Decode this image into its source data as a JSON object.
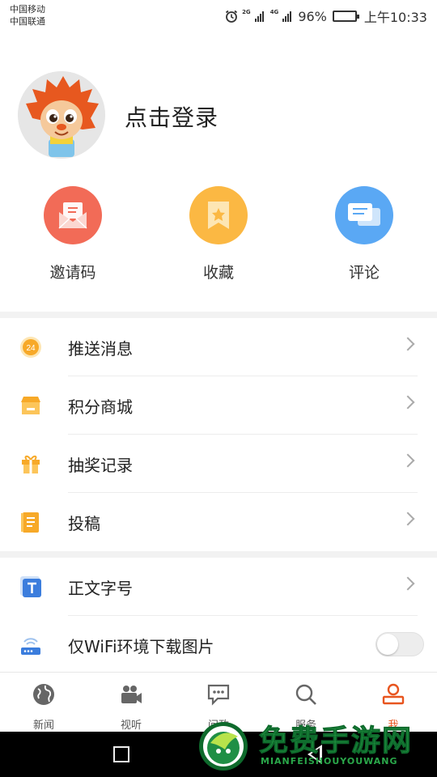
{
  "status_bar": {
    "carrier_1": "中国移动",
    "carrier_2": "中国联通",
    "net_1": "2G",
    "net_2": "4G",
    "battery": "96%",
    "time": "上午10:33",
    "battery_level": 0.96
  },
  "profile": {
    "login_label": "点击登录"
  },
  "quick_actions": [
    {
      "label": "邀请码",
      "color": "#f26b57",
      "icon": "envelope-icon"
    },
    {
      "label": "收藏",
      "color": "#fbb843",
      "icon": "bookmark-icon"
    },
    {
      "label": "评论",
      "color": "#5aa8f4",
      "icon": "chat-bubble-icon"
    }
  ],
  "menu_group_1": [
    {
      "label": "推送消息",
      "icon": "clock-24-icon",
      "color": "#f7a928"
    },
    {
      "label": "积分商城",
      "icon": "store-icon",
      "color": "#f7a928"
    },
    {
      "label": "抽奖记录",
      "icon": "gift-icon",
      "color": "#f7a928"
    },
    {
      "label": "投稿",
      "icon": "document-icon",
      "color": "#f7a928"
    }
  ],
  "menu_group_2": [
    {
      "label": "正文字号",
      "icon": "font-size-icon",
      "color": "#3b7ddd"
    },
    {
      "label": "仅WiFi环境下载图片",
      "icon": "wifi-router-icon",
      "color": "#3b7ddd",
      "toggle_on": false
    }
  ],
  "tabs": [
    {
      "label": "新闻",
      "icon": "globe-icon",
      "active": false
    },
    {
      "label": "视听",
      "icon": "video-camera-icon",
      "active": false
    },
    {
      "label": "问政",
      "icon": "chat-icon",
      "active": false
    },
    {
      "label": "服务",
      "icon": "search-icon",
      "active": false
    },
    {
      "label": "我",
      "icon": "person-icon",
      "active": true
    }
  ],
  "watermark": {
    "title": "免费手游网",
    "subtitle": "MIANFEISHOUYOUWANG"
  },
  "colors": {
    "accent": "#e8551f",
    "watermark_green": "#2aa84a"
  }
}
